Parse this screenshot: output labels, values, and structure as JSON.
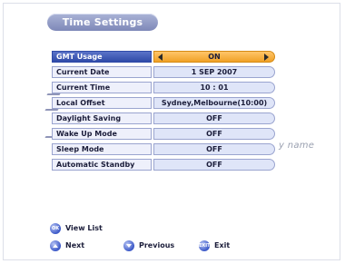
{
  "header": {
    "title": "Time Settings"
  },
  "settings": [
    {
      "label": "GMT Usage",
      "value": "ON"
    },
    {
      "label": "Current Date",
      "value": "1  SEP  2007"
    },
    {
      "label": "Current Time",
      "value": "10 : 01"
    },
    {
      "label": "Local Offset",
      "value": "Sydney,Melbourne(10:00)"
    },
    {
      "label": "Daylight Saving",
      "value": "OFF"
    },
    {
      "label": "Wake Up Mode",
      "value": "OFF"
    },
    {
      "label": "Sleep Mode",
      "value": "OFF"
    },
    {
      "label": "Automatic Standby",
      "value": "OFF"
    }
  ],
  "background_overlay": {
    "text": "y name"
  },
  "legend": {
    "view_list": {
      "key": "OK",
      "label": "View List"
    },
    "next": {
      "label": "Next"
    },
    "previous": {
      "label": "Previous"
    },
    "exit": {
      "key": "EXIT",
      "label": "Exit"
    }
  },
  "colors": {
    "selected_label": "#2f4aa8",
    "selected_value": "#f0a126",
    "row_value": "#dfe5f8",
    "title_pill": "#7e88b8"
  }
}
